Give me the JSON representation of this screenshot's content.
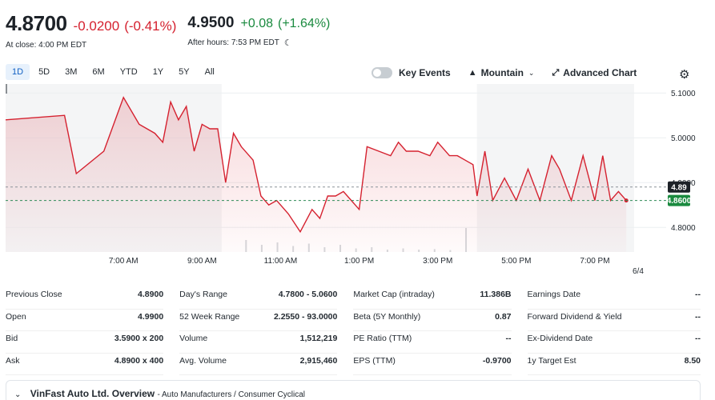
{
  "quote": {
    "close_price": "4.8700",
    "close_change": "-0.0200",
    "close_change_pct": "(-0.41%)",
    "close_label": "At close: 4:00 PM EDT",
    "after_price": "4.9500",
    "after_change": "+0.08",
    "after_change_pct": "(+1.64%)",
    "after_label": "After hours: 7:53 PM EDT"
  },
  "range_tabs": [
    "1D",
    "5D",
    "3M",
    "6M",
    "YTD",
    "1Y",
    "5Y",
    "All"
  ],
  "active_range": "1D",
  "controls": {
    "key_events": "Key Events",
    "chart_type": "Mountain",
    "advanced_chart": "Advanced Chart"
  },
  "colors": {
    "negative": "#d5212f",
    "positive": "#1a8a3f",
    "line": "#d5212f",
    "accent": "#1261c4"
  },
  "chart_data": {
    "type": "area",
    "x_labels": [
      "7:00 AM",
      "9:00 AM",
      "11:00 AM",
      "1:00 PM",
      "3:00 PM",
      "5:00 PM",
      "7:00 PM"
    ],
    "date_label": "6/4",
    "y_ticks": [
      "5.1000",
      "5.0000",
      "4.9000",
      "4.8000"
    ],
    "ylim": [
      4.745,
      5.12
    ],
    "previous_close_line": 4.89,
    "current_line": 4.86,
    "markers": [
      {
        "label": "4.89",
        "value": 4.89
      },
      {
        "label": "4.8600",
        "value": 4.86
      }
    ],
    "x_range_hours": [
      4,
      20
    ],
    "series": [
      {
        "x": [
          4.0,
          5.5,
          5.8,
          6.5,
          7.0,
          7.4,
          7.8,
          8.0,
          8.2,
          8.4,
          8.6,
          8.8,
          9.0,
          9.2,
          9.4,
          9.6,
          9.8,
          10.0,
          10.2,
          10.3,
          10.5,
          10.7,
          10.9,
          11.0,
          11.2,
          11.5,
          11.8,
          12.0,
          12.2,
          12.4,
          12.6,
          12.8,
          13.0,
          13.2,
          13.5,
          13.8,
          14.0,
          14.2,
          14.5,
          14.8,
          15.0,
          15.3,
          15.5,
          15.7,
          15.9,
          16.0,
          16.2,
          16.4,
          16.7,
          17.0,
          17.3,
          17.6,
          17.9,
          18.1,
          18.4,
          18.7,
          19.0,
          19.2,
          19.4,
          19.6,
          19.8
        ],
        "values": [
          5.04,
          5.05,
          4.92,
          4.97,
          5.09,
          5.03,
          5.01,
          4.99,
          5.08,
          5.04,
          5.07,
          4.97,
          5.03,
          5.02,
          5.02,
          4.9,
          5.01,
          4.98,
          4.96,
          4.95,
          4.87,
          4.85,
          4.86,
          4.85,
          4.83,
          4.79,
          4.84,
          4.82,
          4.87,
          4.87,
          4.88,
          4.86,
          4.84,
          4.98,
          4.97,
          4.96,
          4.99,
          4.97,
          4.97,
          4.96,
          4.99,
          4.96,
          4.96,
          4.95,
          4.94,
          4.87,
          4.97,
          4.86,
          4.91,
          4.86,
          4.93,
          4.86,
          4.96,
          4.93,
          4.86,
          4.96,
          4.86,
          4.96,
          4.86,
          4.88,
          4.86
        ]
      }
    ],
    "volume_bars_hours": [
      10.1,
      10.5,
      10.9,
      11.3,
      11.7,
      12.1,
      12.5,
      12.9,
      13.3,
      13.7,
      14.1,
      14.5,
      14.9,
      15.3,
      15.7
    ],
    "volume_bars_values": [
      0.5,
      0.3,
      0.4,
      0.25,
      0.35,
      0.2,
      0.3,
      0.15,
      0.2,
      0.1,
      0.15,
      0.1,
      0.12,
      0.08,
      1.0
    ]
  },
  "stats": [
    [
      {
        "label": "Previous Close",
        "value": "4.8900"
      },
      {
        "label": "Open",
        "value": "4.9900"
      },
      {
        "label": "Bid",
        "value": "3.5900 x 200"
      },
      {
        "label": "Ask",
        "value": "4.8900 x 400"
      }
    ],
    [
      {
        "label": "Day's Range",
        "value": "4.7800 - 5.0600"
      },
      {
        "label": "52 Week Range",
        "value": "2.2550 - 93.0000"
      },
      {
        "label": "Volume",
        "value": "1,512,219"
      },
      {
        "label": "Avg. Volume",
        "value": "2,915,460"
      }
    ],
    [
      {
        "label": "Market Cap (intraday)",
        "value": "11.386B"
      },
      {
        "label": "Beta (5Y Monthly)",
        "value": "0.87"
      },
      {
        "label": "PE Ratio (TTM)",
        "value": "--"
      },
      {
        "label": "EPS (TTM)",
        "value": "-0.9700"
      }
    ],
    [
      {
        "label": "Earnings Date",
        "value": "--"
      },
      {
        "label": "Forward Dividend & Yield",
        "value": "--"
      },
      {
        "label": "Ex-Dividend Date",
        "value": "--"
      },
      {
        "label": "1y Target Est",
        "value": "8.50"
      }
    ]
  ],
  "overview": {
    "title": "VinFast Auto Ltd. Overview",
    "meta": "Auto Manufacturers / Consumer Cyclical"
  }
}
